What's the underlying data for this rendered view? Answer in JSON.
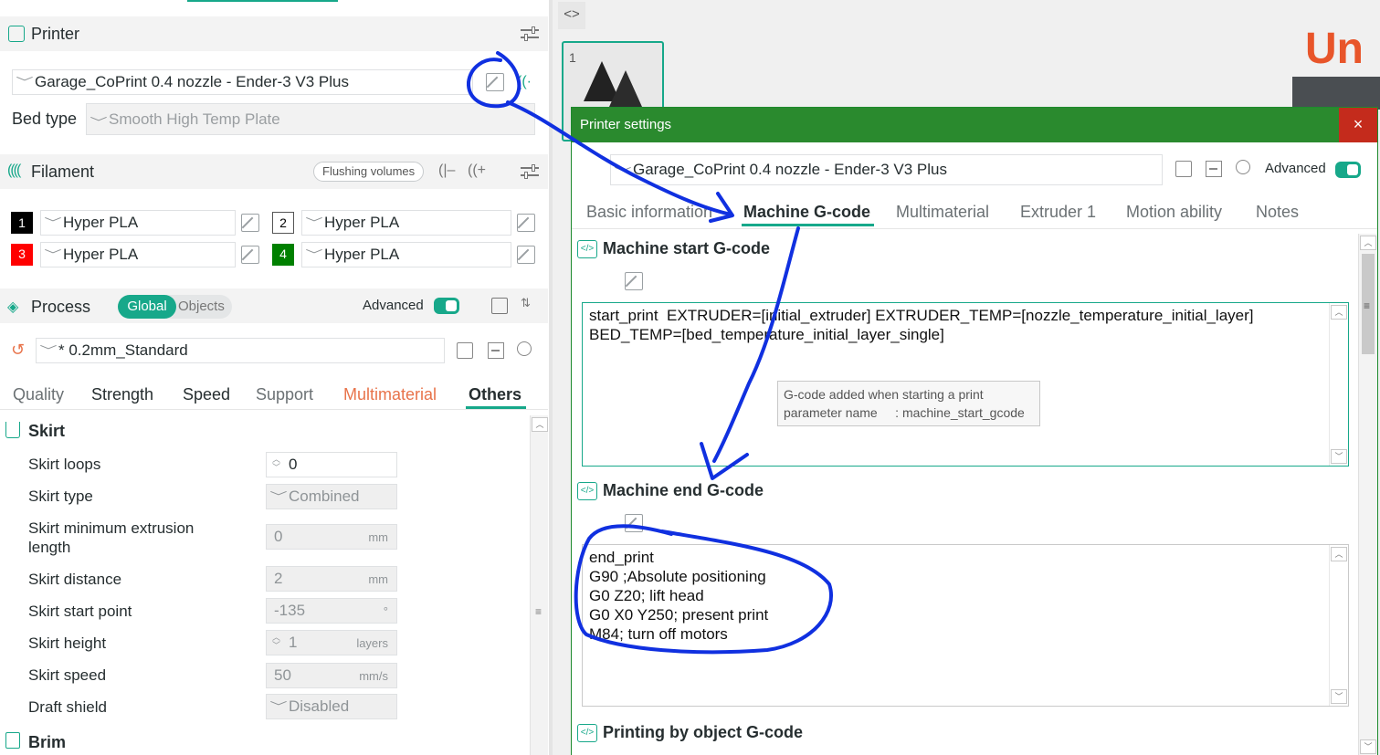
{
  "printer": {
    "title": "Printer",
    "preset": "Garage_CoPrint 0.4 nozzle - Ender-3 V3 Plus",
    "bed_type_label": "Bed type",
    "bed_type_value": "Smooth High Temp Plate"
  },
  "filament": {
    "title": "Filament",
    "flushing_button": "Flushing volumes",
    "slots": [
      {
        "num": "1",
        "name": "Hyper PLA",
        "color": "#000000",
        "text_color": "#ffffff"
      },
      {
        "num": "2",
        "name": "Hyper PLA",
        "color": "#ffffff",
        "text_color": "#000000"
      },
      {
        "num": "3",
        "name": "Hyper PLA",
        "color": "#ff0000",
        "text_color": "#ffffff"
      },
      {
        "num": "4",
        "name": "Hyper PLA",
        "color": "#008000",
        "text_color": "#ffffff"
      }
    ]
  },
  "process": {
    "title": "Process",
    "global_label": "Global",
    "objects_label": "Objects",
    "advanced_label": "Advanced",
    "preset": "* 0.2mm_Standard",
    "tabs": [
      "Quality",
      "Strength",
      "Speed",
      "Support",
      "Multimaterial",
      "Others"
    ],
    "active_tab": "Others",
    "skirt_title": "Skirt",
    "brim_title": "Brim",
    "params": [
      {
        "label": "Skirt loops",
        "value": "0",
        "unit": ""
      },
      {
        "label": "Skirt type",
        "value": "Combined",
        "unit": ""
      },
      {
        "label": "Skirt minimum extrusion",
        "label2": "length",
        "value": "0",
        "unit": "mm"
      },
      {
        "label": "Skirt distance",
        "value": "2",
        "unit": "mm"
      },
      {
        "label": "Skirt start point",
        "value": "-135",
        "unit": "°"
      },
      {
        "label": "Skirt height",
        "value": "1",
        "unit": "layers"
      },
      {
        "label": "Skirt speed",
        "value": "50",
        "unit": "mm/s"
      },
      {
        "label": "Draft shield",
        "value": "Disabled",
        "unit": ""
      }
    ]
  },
  "plate": {
    "number": "1",
    "logo_fragment": "Un"
  },
  "dialog": {
    "title": "Printer settings",
    "close": "×",
    "preset": "Garage_CoPrint 0.4 nozzle - Ender-3 V3 Plus",
    "advanced_label": "Advanced",
    "tabs": [
      "Basic information",
      "Machine G-code",
      "Multimaterial",
      "Extruder 1",
      "Motion ability",
      "Notes"
    ],
    "active_tab": "Machine G-code",
    "start_gcode_title": "Machine start G-code",
    "start_gcode_lines": [
      "start_print  EXTRUDER=[initial_extruder] EXTRUDER_TEMP=[nozzle_temperature_initial_layer]",
      "BED_TEMP=[bed_temperature_initial_layer_single]"
    ],
    "tooltip_line1": "G-code added when starting a print",
    "tooltip_line2": "parameter name     : machine_start_gcode",
    "end_gcode_title": "Machine end G-code",
    "end_gcode_lines": [
      "end_print",
      "G90 ;Absolute positioning",
      "G0 Z20; lift head",
      "G0 X0 Y250; present print",
      "M84; turn off motors"
    ],
    "object_gcode_title": "Printing by object G-code"
  },
  "colors": {
    "accent": "#17a88a",
    "dialog_title_bar": "#2a8a2e",
    "close_button": "#c42b1c",
    "annotation": "#1030e0",
    "multimaterial_tab": "#e8734a",
    "logo": "#e8552a"
  }
}
